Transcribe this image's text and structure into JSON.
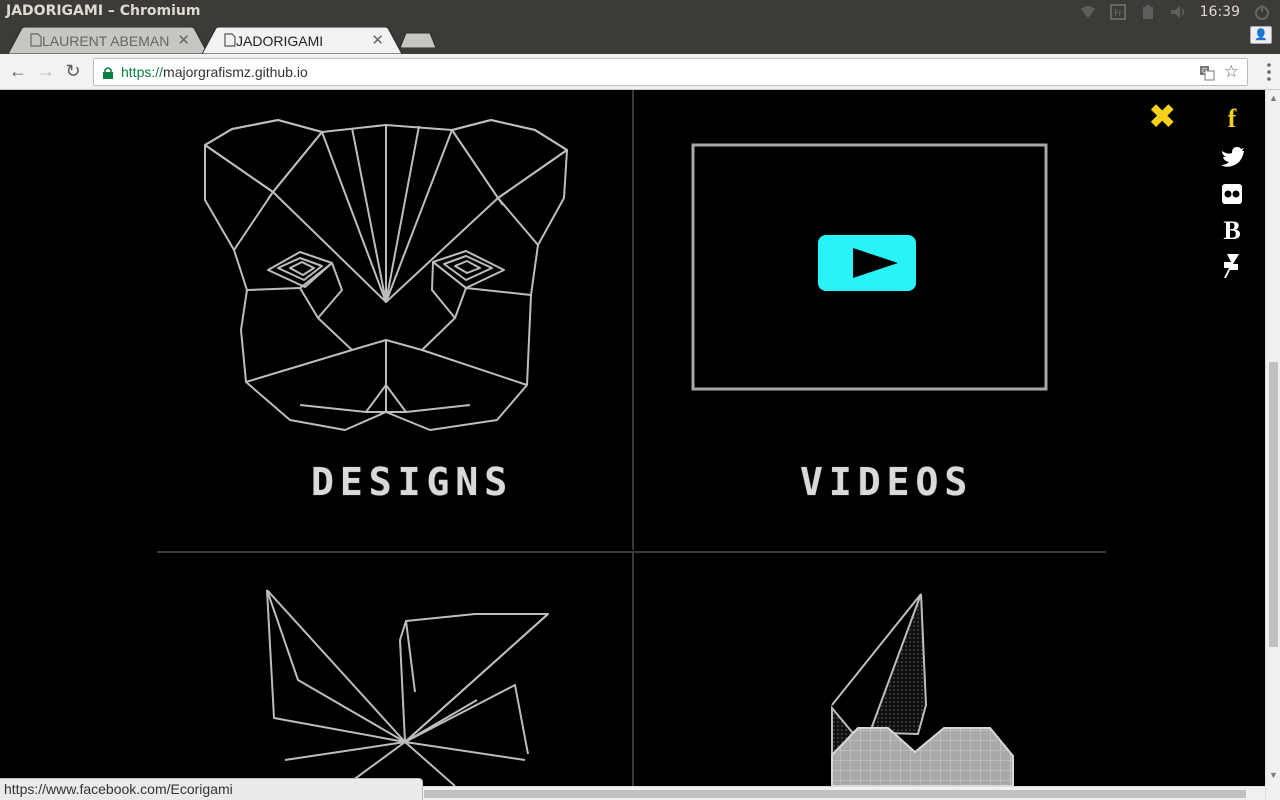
{
  "window": {
    "title": "JADORIGAMI – Chromium",
    "clock": "16:39",
    "tray_icons": [
      "wifi-icon",
      "keyboard-icon",
      "battery-icon",
      "volume-icon",
      "power-icon"
    ]
  },
  "tabs": [
    {
      "label": "LAURENT ABEMAN",
      "active": false
    },
    {
      "label": "JADORIGAMI",
      "active": true
    }
  ],
  "toolbar": {
    "url_scheme": "https://",
    "url_host": "majorgrafismz.github.io"
  },
  "page": {
    "tiles": [
      {
        "label": "DESIGNS"
      },
      {
        "label": "VIDEOS"
      }
    ],
    "accent_color": "#f7d11b",
    "play_color": "#27f3f9",
    "social": [
      {
        "name": "facebook-icon",
        "glyph": "f"
      },
      {
        "name": "twitter-icon"
      },
      {
        "name": "flickr-icon"
      },
      {
        "name": "behance-icon",
        "glyph": "B"
      },
      {
        "name": "deviantart-icon"
      }
    ]
  },
  "status_bar": {
    "link_url": "https://www.facebook.com/Ecorigami"
  }
}
